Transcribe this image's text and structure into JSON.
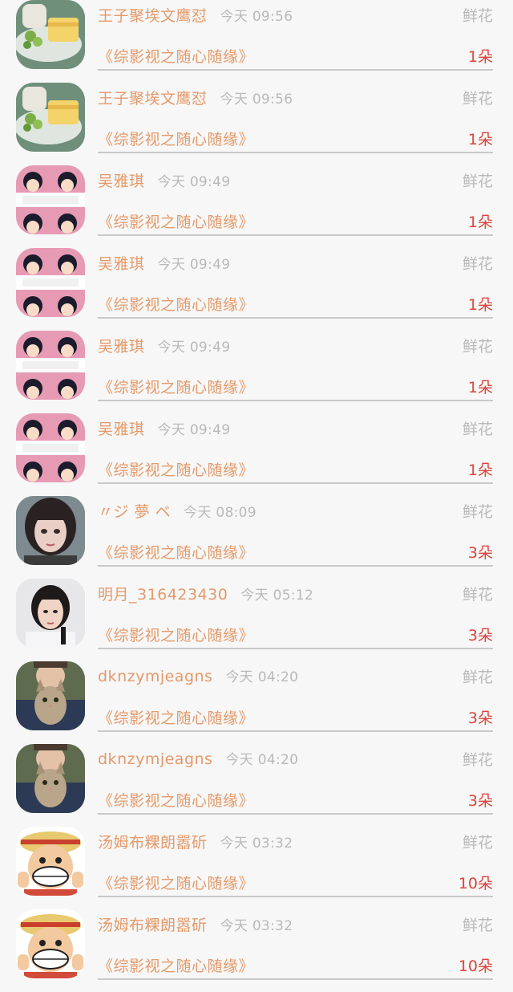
{
  "colors": {
    "name": "#e49a6a",
    "time": "#b9b9b9",
    "amount": "#d9453f",
    "divider": "#c9c9c9",
    "background": "#f7f7f7"
  },
  "records": [
    {
      "avatar": "food-photo",
      "name": "王子聚埃文鹰怼",
      "time": "今天 09:56",
      "gift_type": "鲜花",
      "book": "《综影视之随心随缘》",
      "amount": "1朵"
    },
    {
      "avatar": "food-photo",
      "name": "王子聚埃文鹰怼",
      "time": "今天 09:56",
      "gift_type": "鲜花",
      "book": "《综影视之随心随缘》",
      "amount": "1朵"
    },
    {
      "avatar": "cartoon-girl",
      "name": "吴雅琪",
      "time": "今天 09:49",
      "gift_type": "鲜花",
      "book": "《综影视之随心随缘》",
      "amount": "1朵"
    },
    {
      "avatar": "cartoon-girl",
      "name": "吴雅琪",
      "time": "今天 09:49",
      "gift_type": "鲜花",
      "book": "《综影视之随心随缘》",
      "amount": "1朵"
    },
    {
      "avatar": "cartoon-girl",
      "name": "吴雅琪",
      "time": "今天 09:49",
      "gift_type": "鲜花",
      "book": "《综影视之随心随缘》",
      "amount": "1朵"
    },
    {
      "avatar": "cartoon-girl",
      "name": "吴雅琪",
      "time": "今天 09:49",
      "gift_type": "鲜花",
      "book": "《综影视之随心随缘》",
      "amount": "1朵"
    },
    {
      "avatar": "woman-photo",
      "name": "〃ジ 夢 ベ",
      "time": "今天 08:09",
      "gift_type": "鲜花",
      "book": "《综影视之随心随缘》",
      "amount": "3朵"
    },
    {
      "avatar": "girl-photo",
      "name": "明月_316423430",
      "time": "今天 05:12",
      "gift_type": "鲜花",
      "book": "《综影视之随心随缘》",
      "amount": "3朵"
    },
    {
      "avatar": "cat-photo",
      "name": "dknzymjeagns",
      "time": "今天 04:20",
      "gift_type": "鲜花",
      "book": "《综影视之随心随缘》",
      "amount": "3朵"
    },
    {
      "avatar": "cat-photo",
      "name": "dknzymjeagns",
      "time": "今天 04:20",
      "gift_type": "鲜花",
      "book": "《综影视之随心随缘》",
      "amount": "3朵"
    },
    {
      "avatar": "luffy-cartoon",
      "name": "汤姆布粿朗嚣斫",
      "time": "今天 03:32",
      "gift_type": "鲜花",
      "book": "《综影视之随心随缘》",
      "amount": "10朵"
    },
    {
      "avatar": "luffy-cartoon",
      "name": "汤姆布粿朗嚣斫",
      "time": "今天 03:32",
      "gift_type": "鲜花",
      "book": "《综影视之随心随缘》",
      "amount": "10朵"
    }
  ]
}
